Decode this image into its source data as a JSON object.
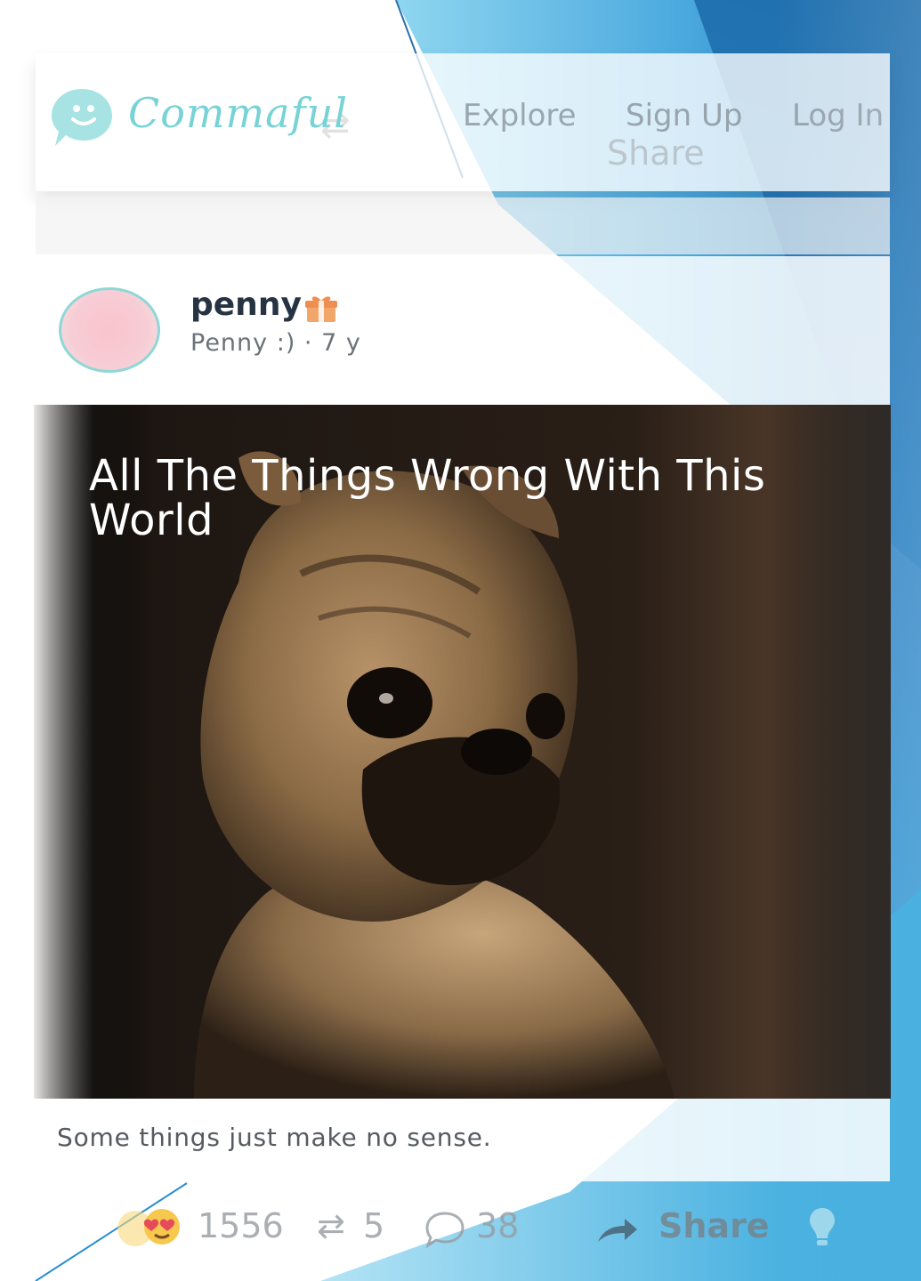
{
  "header": {
    "brand": "Commaful",
    "nav": [
      "Explore",
      "Sign Up",
      "Log In"
    ],
    "share_ghost": "Share"
  },
  "post": {
    "username": "penny",
    "subline": "Penny :) · 7 y",
    "title": "All The Things Wrong With This World",
    "caption": "Some things just make no sense."
  },
  "stats": {
    "reactions": "1556",
    "reposts": "5",
    "comments": "38",
    "share_label": "Share"
  },
  "colors": {
    "brand_teal": "#78d3d6",
    "slide_blue": "#2a8ed0",
    "username": "#263342"
  },
  "icons": [
    "commaful-logo-icon",
    "gift-icon",
    "repost-icon",
    "comment-icon",
    "share-arrow-icon",
    "heart-eyes-emoji-icon",
    "bulb-icon"
  ]
}
